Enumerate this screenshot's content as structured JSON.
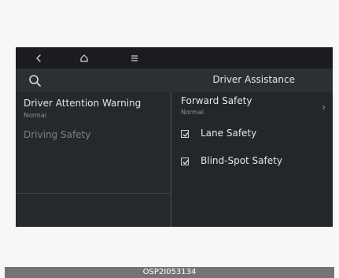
{
  "top_nav": {
    "back_icon": "chevron-left-icon",
    "home_icon": "home-icon",
    "menu_icon": "menu-icon"
  },
  "header": {
    "search_icon": "search-icon",
    "title": "Driver Assistance"
  },
  "left_menu": {
    "items": [
      {
        "label": "Driver Attention Warning",
        "sub": "Normal"
      },
      {
        "label": "Driving Safety",
        "sub": ""
      }
    ]
  },
  "right_settings": {
    "forward": {
      "label": "Forward Safety",
      "sub": "Normal",
      "chevron_icon": "chevron-right-icon"
    },
    "checks": [
      {
        "label": "Lane Safety",
        "checked": true
      },
      {
        "label": "Blind-Spot Safety",
        "checked": true
      }
    ]
  },
  "caption": {
    "text": "OSP2I053134"
  },
  "colors": {
    "screen_background": "#23262b",
    "top_bar": "#1a1c20",
    "text_primary": "#e7e7e7",
    "text_secondary": "#8f9398",
    "caption_bar": "#747474"
  }
}
